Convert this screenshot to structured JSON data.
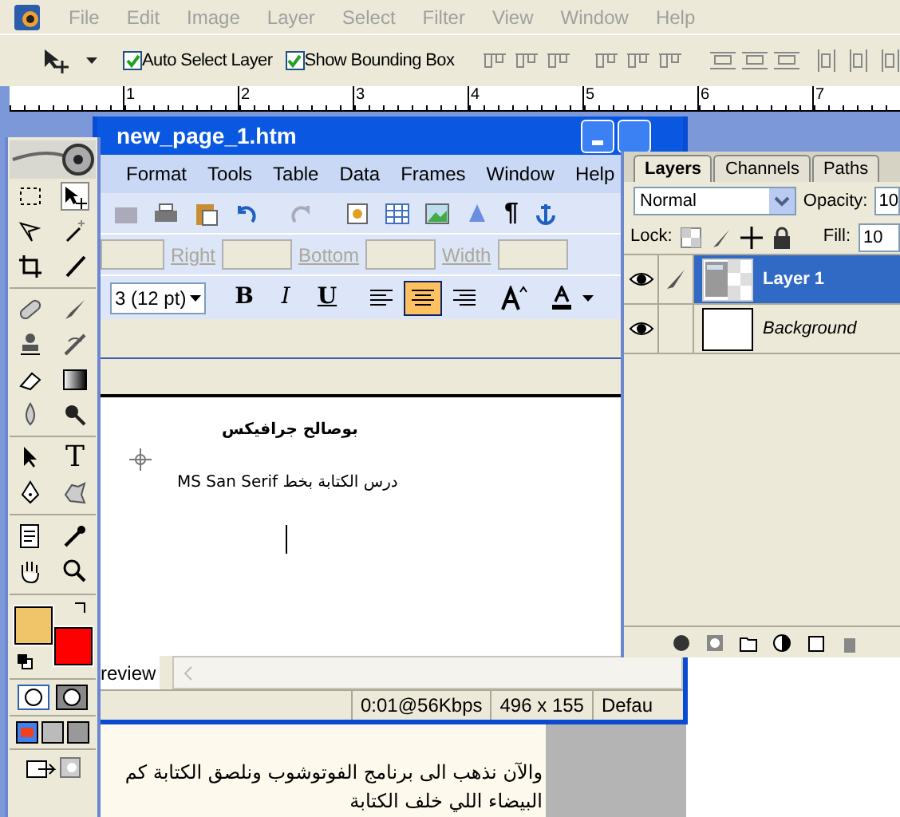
{
  "menu_bar": {
    "items": [
      "File",
      "Edit",
      "Image",
      "Layer",
      "Select",
      "Filter",
      "View",
      "Window",
      "Help"
    ]
  },
  "options_bar": {
    "checkboxes": [
      {
        "label": "Auto Select Layer",
        "checked": true
      },
      {
        "label": "Show Bounding Box",
        "checked": true
      }
    ]
  },
  "ruler": {
    "ticks": [
      "1",
      "2",
      "3",
      "4",
      "5",
      "6",
      "7"
    ]
  },
  "toolbox": {
    "text_tool": "T",
    "swatches": [
      {
        "kind": "foreground",
        "color": "#f0c468"
      },
      {
        "kind": "background",
        "color": "#ff0000"
      }
    ]
  },
  "editor_window": {
    "title": "new_page_1.htm",
    "menu": [
      "Format",
      "Tools",
      "Table",
      "Data",
      "Frames",
      "Window",
      "Help"
    ],
    "pilcrow": "¶",
    "position_fields": [
      {
        "label": "Right"
      },
      {
        "label": "Bottom"
      },
      {
        "label": "Width"
      }
    ],
    "font_size": "3 (12 pt)",
    "format_buttons": [
      {
        "label": "B",
        "selected": false
      },
      {
        "label": "I",
        "selected": false
      },
      {
        "label": "U",
        "selected": false
      }
    ],
    "align_buttons": [
      {
        "kind": "left",
        "selected": false
      },
      {
        "kind": "center",
        "selected": true
      },
      {
        "kind": "right",
        "selected": false
      }
    ],
    "document": {
      "lines": [
        "بوصالح جرافيكس",
        "درس الكتابة بخط MS San Serif"
      ]
    },
    "view_tab": "review",
    "status": [
      "0:01@56Kbps",
      "496 x 155",
      "Defau"
    ]
  },
  "layers_panel": {
    "tabs": [
      {
        "label": "Layers",
        "selected": true
      },
      {
        "label": "Channels",
        "selected": false
      },
      {
        "label": "Paths",
        "selected": false
      }
    ],
    "blend_mode": "Normal",
    "opacity_label": "Opacity:",
    "opacity": "10",
    "lock_label": "Lock:",
    "fill_label": "Fill:",
    "fill": "10",
    "layers": [
      {
        "name": "Layer 1",
        "selected": true,
        "visible": true,
        "linked": true
      },
      {
        "name": "Background",
        "selected": false,
        "visible": true,
        "linked": false
      }
    ]
  },
  "background_page": {
    "lines": [
      "والآن نذهب الى برنامج الفوتوشوب ونلصق الكتابة كم",
      "البيضاء اللي خلف الكتابة"
    ]
  }
}
